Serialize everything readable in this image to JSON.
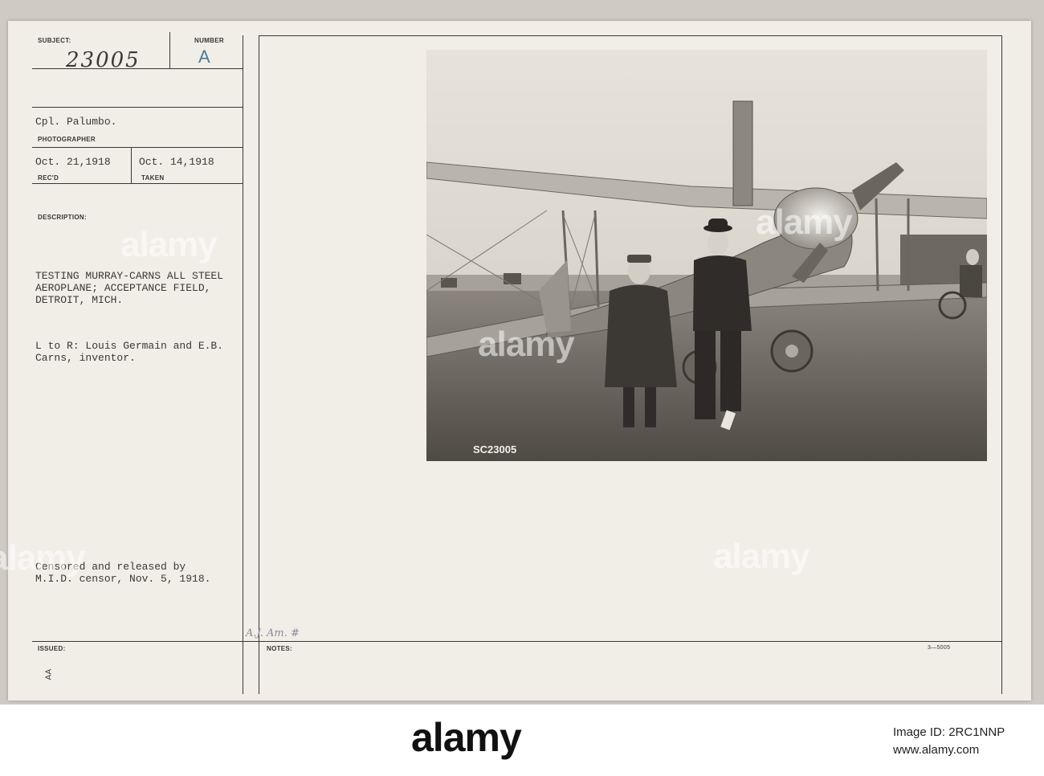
{
  "card": {
    "subject_label": "SUBJECT:",
    "number_label": "NUMBER",
    "subject_value": "23005",
    "number_value": "A",
    "photographer_value": "Cpl. Palumbo.",
    "photographer_label": "PHOTOGRAPHER",
    "recd_value": "Oct. 21,1918",
    "recd_label": "REC'D",
    "taken_value": "Oct. 14,1918",
    "taken_label": "TAKEN",
    "description_label": "DESCRIPTION:",
    "description": "TESTING MURRAY-CARNS ALL STEEL\nAEROPLANE; ACCEPTANCE FIELD,\nDETROIT, MICH.",
    "caption": "L to R: Louis Germain and E.B.\nCarns, inventor.",
    "censor": "Censored and released by\nM.I.D. censor, Nov. 5, 1918.",
    "issued_label": "ISSUED:",
    "notes_label": "NOTES:",
    "notes_hand": "A.J. Am. #",
    "vertical_mark": "AA",
    "form_number": "3—5005"
  },
  "photo": {
    "plate_number": "SC23005"
  },
  "watermark": "alamy",
  "footer": {
    "logo": "alamy",
    "image_id_label": "Image ID: 2RC1NNP",
    "url": "www.alamy.com"
  }
}
